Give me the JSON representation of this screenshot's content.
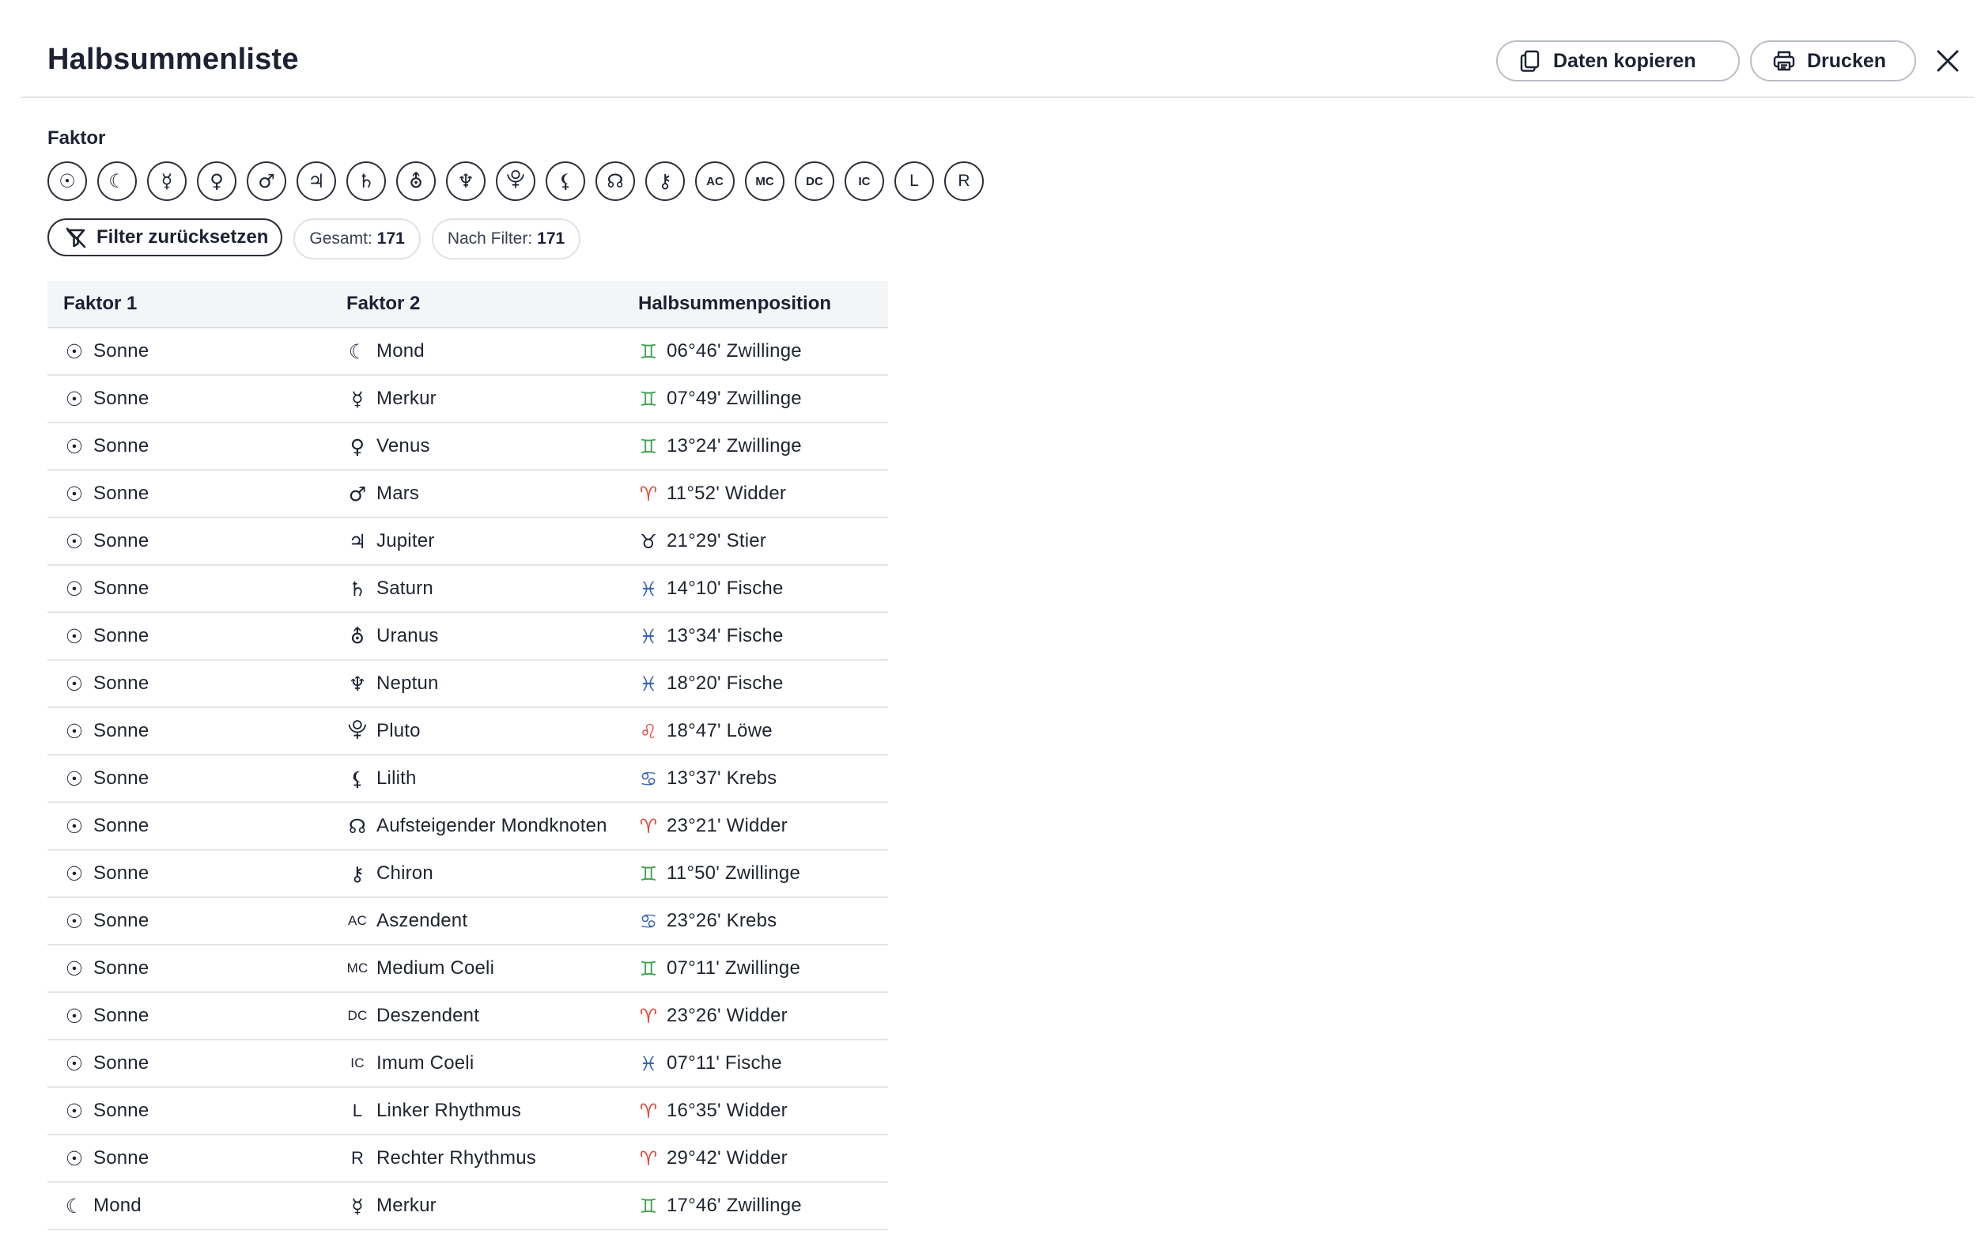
{
  "header": {
    "title": "Halbsummenliste",
    "copy_label": "Daten kopieren",
    "print_label": "Drucken"
  },
  "filter": {
    "label": "Faktor",
    "factors": [
      {
        "glyph": "☉",
        "name": "sun-icon",
        "kind": "glyph"
      },
      {
        "glyph": "☾",
        "name": "moon-icon",
        "kind": "glyph"
      },
      {
        "glyph": "☿",
        "name": "mercury-icon",
        "kind": "glyph"
      },
      {
        "glyph": "♀",
        "name": "venus-icon",
        "kind": "glyph"
      },
      {
        "glyph": "♂",
        "name": "mars-icon",
        "kind": "glyph"
      },
      {
        "glyph": "♃",
        "name": "jupiter-icon",
        "kind": "glyph"
      },
      {
        "glyph": "♄",
        "name": "saturn-icon",
        "kind": "glyph"
      },
      {
        "glyph": "⛢",
        "name": "uranus-icon",
        "kind": "glyph"
      },
      {
        "glyph": "♆",
        "name": "neptune-icon",
        "kind": "glyph"
      },
      {
        "glyph": "⯓",
        "name": "pluto-icon",
        "kind": "glyph"
      },
      {
        "glyph": "⚸",
        "name": "lilith-icon",
        "kind": "glyph"
      },
      {
        "glyph": "☊",
        "name": "north-node-icon",
        "kind": "glyph"
      },
      {
        "glyph": "⚷",
        "name": "chiron-icon",
        "kind": "glyph"
      },
      {
        "glyph": "AC",
        "name": "ascendant-icon",
        "kind": "small"
      },
      {
        "glyph": "MC",
        "name": "medium-coeli-icon",
        "kind": "small"
      },
      {
        "glyph": "DC",
        "name": "descendant-icon",
        "kind": "small"
      },
      {
        "glyph": "IC",
        "name": "imum-coeli-icon",
        "kind": "small"
      },
      {
        "glyph": "L",
        "name": "left-rhythm-icon",
        "kind": "letter"
      },
      {
        "glyph": "R",
        "name": "right-rhythm-icon",
        "kind": "letter"
      }
    ],
    "reset_label": "Filter zurücksetzen",
    "total_label": "Gesamt:",
    "total_value": "171",
    "filtered_label": "Nach Filter:",
    "filtered_value": "171"
  },
  "table": {
    "columns": [
      "Faktor 1",
      "Faktor 2",
      "Halbsummenposition"
    ],
    "colors": {
      "fire": "#e0463a",
      "earth": "#1c2233",
      "air": "#3fa34d",
      "water": "#3b63b5"
    },
    "rows": [
      {
        "f1": "Sonne",
        "f1_sym": "☉",
        "f2": "Mond",
        "f2_sym": "☾",
        "pos": "06°46' Zwillinge",
        "z": "♊",
        "el": "air"
      },
      {
        "f1": "Sonne",
        "f1_sym": "☉",
        "f2": "Merkur",
        "f2_sym": "☿",
        "pos": "07°49' Zwillinge",
        "z": "♊",
        "el": "air"
      },
      {
        "f1": "Sonne",
        "f1_sym": "☉",
        "f2": "Venus",
        "f2_sym": "♀",
        "pos": "13°24' Zwillinge",
        "z": "♊",
        "el": "air"
      },
      {
        "f1": "Sonne",
        "f1_sym": "☉",
        "f2": "Mars",
        "f2_sym": "♂",
        "pos": "11°52' Widder",
        "z": "♈",
        "el": "fire"
      },
      {
        "f1": "Sonne",
        "f1_sym": "☉",
        "f2": "Jupiter",
        "f2_sym": "♃",
        "pos": "21°29' Stier",
        "z": "♉",
        "el": "earth"
      },
      {
        "f1": "Sonne",
        "f1_sym": "☉",
        "f2": "Saturn",
        "f2_sym": "♄",
        "pos": "14°10' Fische",
        "z": "♓",
        "el": "water"
      },
      {
        "f1": "Sonne",
        "f1_sym": "☉",
        "f2": "Uranus",
        "f2_sym": "⛢",
        "pos": "13°34' Fische",
        "z": "♓",
        "el": "water"
      },
      {
        "f1": "Sonne",
        "f1_sym": "☉",
        "f2": "Neptun",
        "f2_sym": "♆",
        "pos": "18°20' Fische",
        "z": "♓",
        "el": "water"
      },
      {
        "f1": "Sonne",
        "f1_sym": "☉",
        "f2": "Pluto",
        "f2_sym": "⯓",
        "pos": "18°47' Löwe",
        "z": "♌",
        "el": "fire"
      },
      {
        "f1": "Sonne",
        "f1_sym": "☉",
        "f2": "Lilith",
        "f2_sym": "⚸",
        "pos": "13°37' Krebs",
        "z": "♋",
        "el": "water"
      },
      {
        "f1": "Sonne",
        "f1_sym": "☉",
        "f2": "Aufsteigender Mondknoten",
        "f2_sym": "☊",
        "pos": "23°21' Widder",
        "z": "♈",
        "el": "fire"
      },
      {
        "f1": "Sonne",
        "f1_sym": "☉",
        "f2": "Chiron",
        "f2_sym": "⚷",
        "pos": "11°50' Zwillinge",
        "z": "♊",
        "el": "air"
      },
      {
        "f1": "Sonne",
        "f1_sym": "☉",
        "f2": "Aszendent",
        "f2_sym": "AC",
        "f2_kind": "txt",
        "pos": "23°26' Krebs",
        "z": "♋",
        "el": "water"
      },
      {
        "f1": "Sonne",
        "f1_sym": "☉",
        "f2": "Medium Coeli",
        "f2_sym": "MC",
        "f2_kind": "txt",
        "pos": "07°11' Zwillinge",
        "z": "♊",
        "el": "air"
      },
      {
        "f1": "Sonne",
        "f1_sym": "☉",
        "f2": "Deszendent",
        "f2_sym": "DC",
        "f2_kind": "txt",
        "pos": "23°26' Widder",
        "z": "♈",
        "el": "fire"
      },
      {
        "f1": "Sonne",
        "f1_sym": "☉",
        "f2": "Imum Coeli",
        "f2_sym": "IC",
        "f2_kind": "txt",
        "pos": "07°11' Fische",
        "z": "♓",
        "el": "water"
      },
      {
        "f1": "Sonne",
        "f1_sym": "☉",
        "f2": "Linker Rhythmus",
        "f2_sym": "L",
        "f2_kind": "ltr",
        "pos": "16°35' Widder",
        "z": "♈",
        "el": "fire"
      },
      {
        "f1": "Sonne",
        "f1_sym": "☉",
        "f2": "Rechter Rhythmus",
        "f2_sym": "R",
        "f2_kind": "ltr",
        "pos": "29°42' Widder",
        "z": "♈",
        "el": "fire"
      },
      {
        "f1": "Mond",
        "f1_sym": "☾",
        "f2": "Merkur",
        "f2_sym": "☿",
        "pos": "17°46' Zwillinge",
        "z": "♊",
        "el": "air"
      }
    ]
  }
}
